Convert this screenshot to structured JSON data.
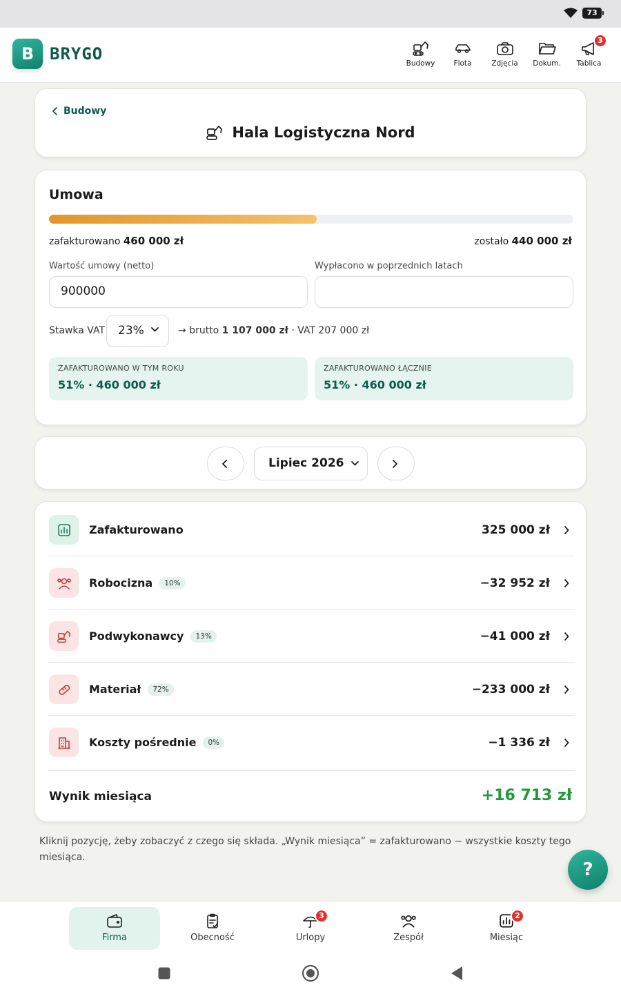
{
  "status": {
    "battery": "73"
  },
  "brand": {
    "initial": "B",
    "name": "BRYGO",
    "accent": "#11806c"
  },
  "topnav": [
    {
      "label": "Budowy",
      "icon": "excavator-icon"
    },
    {
      "label": "Flota",
      "icon": "car-icon"
    },
    {
      "label": "Zdjęcia",
      "icon": "camera-icon"
    },
    {
      "label": "Dokum.",
      "icon": "folder-icon"
    },
    {
      "label": "Tablica",
      "icon": "megaphone-icon",
      "badge": "3"
    }
  ],
  "header": {
    "back_label": "Budowy",
    "title": "Hala Logistyczna Nord"
  },
  "contract": {
    "title": "Umowa",
    "progress": 0.51,
    "invoiced_prefix": "zafakturowano",
    "invoiced_value": "460 000 zł",
    "remaining_prefix": "zostało",
    "remaining_value": "440 000 zł",
    "value_label": "Wartość umowy (netto)",
    "value": "900000",
    "paid_label": "Wypłacono w poprzednich latach",
    "paid_value": "",
    "vat_label": "Stawka VAT",
    "vat_value": "23%",
    "gross_prefix": "→ brutto",
    "gross_value": "1 107 000 zł",
    "vat_info": "· VAT 207 000 zł",
    "stat_year_label": "ZAFAKTUROWANO W TYM ROKU",
    "stat_year_value": "51% · 460 000 zł",
    "stat_total_label": "ZAFAKTUROWANO ŁĄCZNIE",
    "stat_total_value": "51% · 460 000 zł"
  },
  "month": {
    "selected": "Lipiec 2026"
  },
  "summary": {
    "rows": [
      {
        "label": "Zafakturowano",
        "pct": "",
        "amount": "325 000 zł",
        "icon": "chart-icon",
        "tone": "green"
      },
      {
        "label": "Robocizna",
        "pct": "10%",
        "amount": "−32 952 zł",
        "icon": "workers-icon",
        "tone": "red"
      },
      {
        "label": "Podwykonawcy",
        "pct": "13%",
        "amount": "−41 000 zł",
        "icon": "excavator-icon",
        "tone": "red"
      },
      {
        "label": "Materiał",
        "pct": "72%",
        "amount": "−233 000 zł",
        "icon": "brick-icon",
        "tone": "red"
      },
      {
        "label": "Koszty pośrednie",
        "pct": "0%",
        "amount": "−1 336 zł",
        "icon": "building-icon",
        "tone": "red"
      }
    ],
    "result_label": "Wynik miesiąca",
    "result_value": "+16 713 zł"
  },
  "footnote": "Kliknij pozycję, żeby zobaczyć z czego się składa. „Wynik miesiąca” = zafakturowano − wszystkie koszty tego miesiąca.",
  "help": "?",
  "bottomnav": [
    {
      "label": "Firma",
      "icon": "wallet-icon",
      "active": true
    },
    {
      "label": "Obecność",
      "icon": "clipboard-icon"
    },
    {
      "label": "Urlopy",
      "icon": "umbrella-icon",
      "badge": "3"
    },
    {
      "label": "Zespół",
      "icon": "team-icon"
    },
    {
      "label": "Miesiąc",
      "icon": "chart-icon",
      "badge": "2"
    }
  ]
}
